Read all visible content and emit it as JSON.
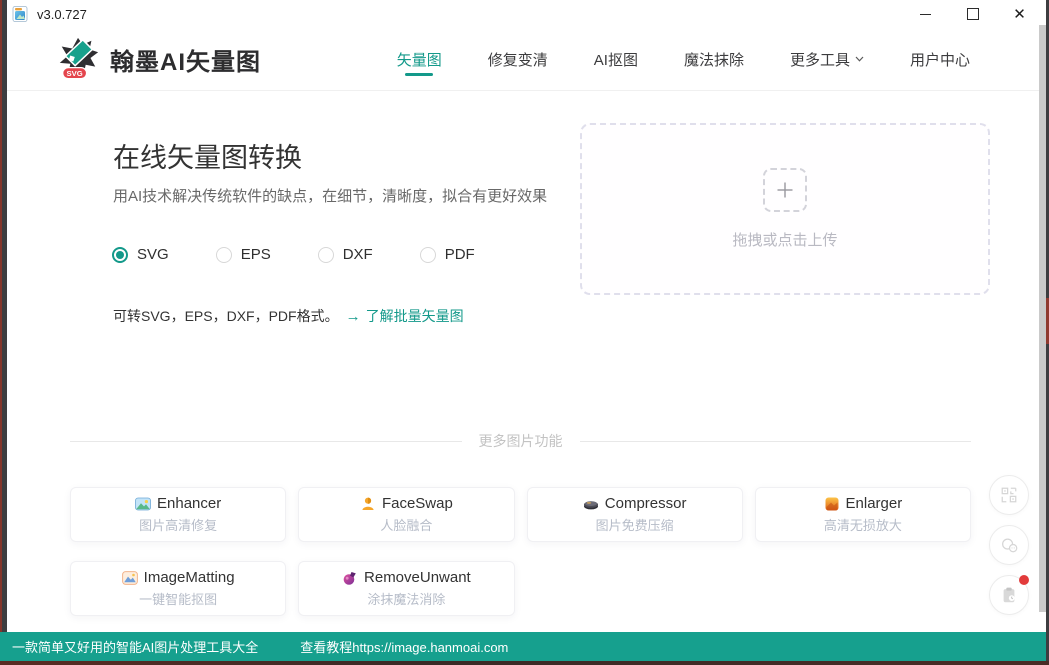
{
  "window": {
    "version": "v3.0.727"
  },
  "header": {
    "brand": "翰墨AI矢量图",
    "logo_badge": "SVG",
    "nav": [
      {
        "label": "矢量图",
        "active": true
      },
      {
        "label": "修复变清",
        "active": false
      },
      {
        "label": "AI抠图",
        "active": false
      },
      {
        "label": "魔法抹除",
        "active": false
      },
      {
        "label": "更多工具",
        "active": false,
        "dropdown": true
      },
      {
        "label": "用户中心",
        "active": false
      }
    ]
  },
  "main": {
    "title": "在线矢量图转换",
    "subtitle": "用AI技术解决传统软件的缺点，在细节，清晰度，拟合有更好效果",
    "formats": [
      {
        "label": "SVG",
        "selected": true
      },
      {
        "label": "EPS",
        "selected": false
      },
      {
        "label": "DXF",
        "selected": false
      },
      {
        "label": "PDF",
        "selected": false
      }
    ],
    "note": "可转SVG，EPS，DXF，PDF格式。",
    "link_arrow": "→",
    "link_text": "了解批量矢量图",
    "upload_text": "拖拽或点击上传"
  },
  "more_tools": {
    "divider_label": "更多图片功能",
    "cards": [
      {
        "name": "Enhancer",
        "desc": "图片高清修复",
        "icon": "photo-enhance-icon"
      },
      {
        "name": "FaceSwap",
        "desc": "人脸融合",
        "icon": "person-icon"
      },
      {
        "name": "Compressor",
        "desc": "图片免费压缩",
        "icon": "compress-icon"
      },
      {
        "name": "Enlarger",
        "desc": "高清无损放大",
        "icon": "enlarge-icon"
      },
      {
        "name": "ImageMatting",
        "desc": "一键智能抠图",
        "icon": "matting-icon"
      },
      {
        "name": "RemoveUnwant",
        "desc": "涂抹魔法消除",
        "icon": "magic-remove-icon"
      }
    ]
  },
  "floating_buttons": [
    {
      "icon": "qr-code-icon",
      "has_badge": false
    },
    {
      "icon": "chat-icon",
      "has_badge": false
    },
    {
      "icon": "history-clipboard-icon",
      "has_badge": true
    }
  ],
  "footer": {
    "slogan": "一款简单又好用的智能AI图片处理工具大全",
    "tutorial": "查看教程https://image.hanmoai.com"
  },
  "colors": {
    "accent": "#13998a",
    "footer_bg": "#16a08e",
    "link": "#13998a",
    "notification_red": "#e23b3b",
    "logo_badge_red": "#e4454d"
  }
}
